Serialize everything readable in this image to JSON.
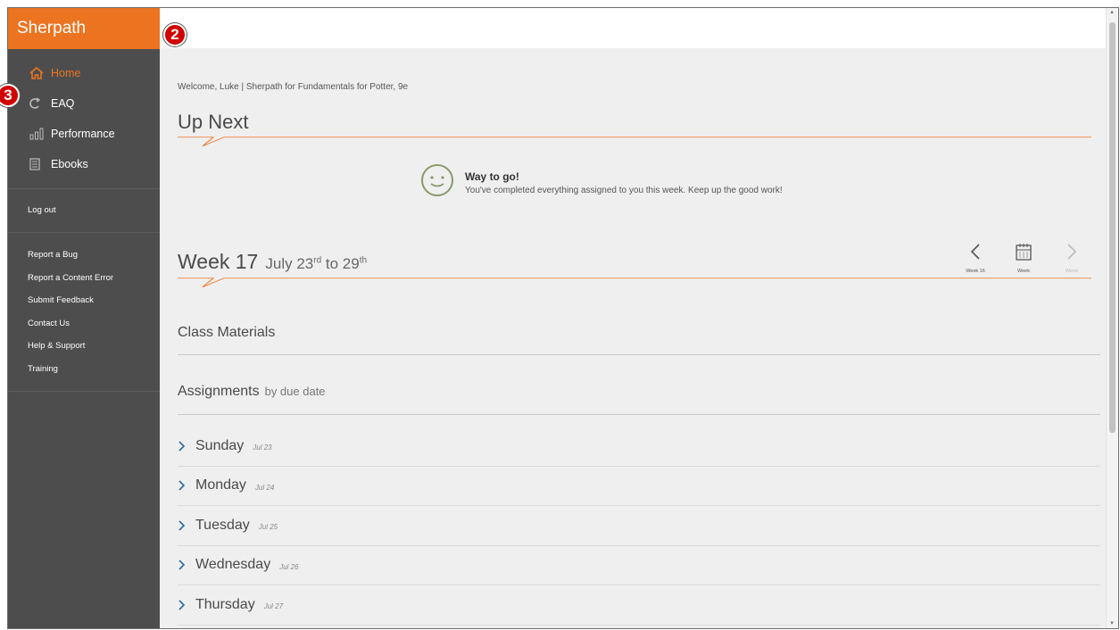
{
  "sidebar": {
    "brand": "Sherpath",
    "nav": [
      {
        "label": "Home",
        "icon": "home-icon",
        "active": true
      },
      {
        "label": "EAQ",
        "icon": "eaq-icon"
      },
      {
        "label": "Performance",
        "icon": "bar-chart-icon"
      },
      {
        "label": "Ebooks",
        "icon": "book-icon"
      }
    ],
    "logout": "Log out",
    "links": [
      "Report a Bug",
      "Report a Content Error",
      "Submit Feedback",
      "Contact Us",
      "Help & Support",
      "Training"
    ]
  },
  "main": {
    "welcome": "Welcome, Luke | Sherpath for Fundamentals for Potter, 9e",
    "up_next": "Up Next",
    "message": {
      "head": "Way to go!",
      "sub": "You've completed everything assigned to you this week. Keep up the good work!"
    },
    "week": {
      "title": "Week 17",
      "dates_start": "July 23",
      "sup_start": "rd",
      "dates_mid": " to 29",
      "sup_end": "th",
      "nav_prev": "Week 16",
      "nav_week": "Week",
      "nav_next": "Week"
    },
    "class_materials": "Class Materials",
    "assignments": "Assignments",
    "assignments_sub": "by due date",
    "days": [
      {
        "name": "Sunday",
        "date": "Jul 23"
      },
      {
        "name": "Monday",
        "date": "Jul 24"
      },
      {
        "name": "Tuesday",
        "date": "Jul 25"
      },
      {
        "name": "Wednesday",
        "date": "Jul 26"
      },
      {
        "name": "Thursday",
        "date": "Jul 27"
      }
    ]
  },
  "callouts": {
    "top": "2",
    "side": "3"
  },
  "colors": {
    "accent": "#ec7421",
    "sidebar": "#4d4d4d",
    "background": "#efefef",
    "callout": "#d10000"
  }
}
